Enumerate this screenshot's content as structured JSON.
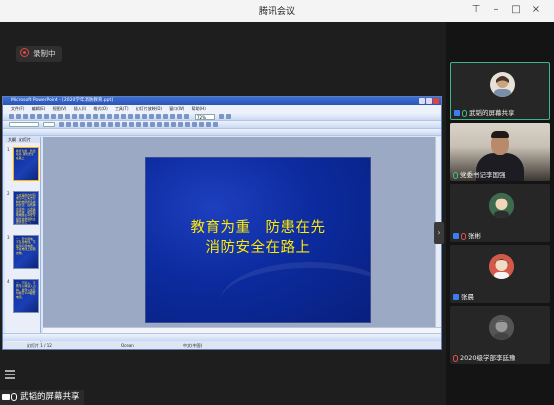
{
  "app": {
    "title": "腾讯会议"
  },
  "recording": {
    "label": "录制中"
  },
  "sharing": {
    "label": "武韬的屏幕共享"
  },
  "ppt": {
    "window_title": "Microsoft PowerPoint - [2020学年消防教育.ppt]",
    "menus": [
      "文件(F)",
      "编辑(E)",
      "视图(V)",
      "插入(I)",
      "格式(O)",
      "工具(T)",
      "幻灯片放映(D)",
      "窗口(W)",
      "帮助(H)"
    ],
    "zoom": "72%",
    "outline_tabs": [
      "大纲",
      "幻灯片"
    ],
    "slide": {
      "line1": "教育为重　防患在先",
      "line2": "消防安全在路上"
    },
    "thumbnails": [
      {
        "num": "1",
        "text": "教育为重　防患在先 消防安全在路上"
      },
      {
        "num": "2",
        "text": "火灾是指在时间或空间上失去控制的燃烧所造成的灾害。在各种灾害中，火灾是最经常、最普遍地威胁公众安全和社会发展的主要灾害之一。"
      },
      {
        "num": "3",
        "text": "一、安全用电，不乱拉电线，不使用劣质电器，不在电线上晾晒衣物。"
      },
      {
        "num": "4",
        "text": "二、不玩火，不携带火种进入山林，发现火灾及时拨打119报警电话。"
      }
    ],
    "status": {
      "slide_counter": "幻灯片 1 / 12",
      "design": "Ocean",
      "language": "中文(中国)"
    }
  },
  "participants": [
    {
      "name": "武韬的屏幕共享",
      "type": "avatar",
      "active": true,
      "mic": "on"
    },
    {
      "name": "党委书记李国强",
      "type": "video",
      "active": false,
      "mic": "on"
    },
    {
      "name": "张彬",
      "type": "avatar",
      "active": false,
      "mic": "muted"
    },
    {
      "name": "张晨",
      "type": "avatar",
      "active": false,
      "mic": "user"
    },
    {
      "name": "2020级学部李廷豫",
      "type": "avatar",
      "active": false,
      "mic": "muted"
    }
  ],
  "colors": {
    "accent": "#3fb585",
    "slide_text": "#ffea00",
    "slide_bg": "#0c2b9e"
  }
}
